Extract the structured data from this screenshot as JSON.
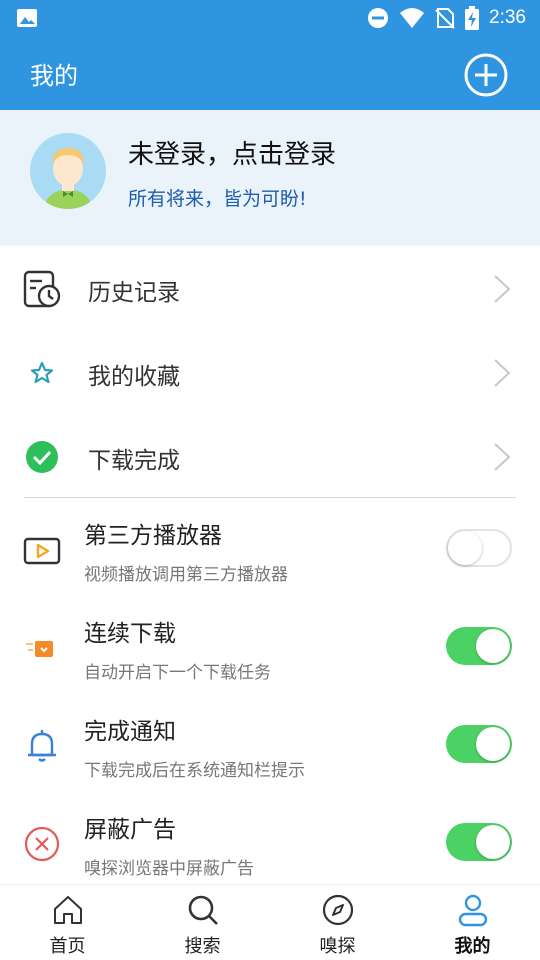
{
  "status_bar": {
    "time": "2:36",
    "icons": [
      "gallery-icon",
      "do-not-disturb-icon",
      "wifi-icon",
      "no-sim-icon",
      "battery-charging-icon"
    ]
  },
  "app_bar": {
    "title": "我的",
    "add_icon": "plus-circle-icon"
  },
  "profile": {
    "login_text": "未登录，点击登录",
    "motto": "所有将来，皆为可盼!"
  },
  "menu": [
    {
      "label": "历史记录",
      "icon": "history-icon"
    },
    {
      "label": "我的收藏",
      "icon": "star-icon"
    },
    {
      "label": "下载完成",
      "icon": "check-circle-icon"
    }
  ],
  "settings": [
    {
      "title": "第三方播放器",
      "desc": "视频播放调用第三方播放器",
      "enabled": false,
      "icon": "player-icon"
    },
    {
      "title": "连续下载",
      "desc": "自动开启下一个下载任务",
      "enabled": true,
      "icon": "continuous-download-icon"
    },
    {
      "title": "完成通知",
      "desc": "下载完成后在系统通知栏提示",
      "enabled": true,
      "icon": "bell-icon"
    },
    {
      "title": "屏蔽广告",
      "desc": "嗅探浏览器中屏蔽广告",
      "enabled": true,
      "icon": "block-ads-icon"
    }
  ],
  "bottom_nav": [
    {
      "label": "首页",
      "icon": "home-icon",
      "active": false
    },
    {
      "label": "搜索",
      "icon": "search-icon",
      "active": false
    },
    {
      "label": "嗅探",
      "icon": "compass-icon",
      "active": false
    },
    {
      "label": "我的",
      "icon": "user-icon",
      "active": true
    }
  ],
  "colors": {
    "primary": "#2f95e0",
    "profile_bg": "#eaf2fa",
    "toggle_on": "#4cd264",
    "motto": "#1f5fa9"
  }
}
